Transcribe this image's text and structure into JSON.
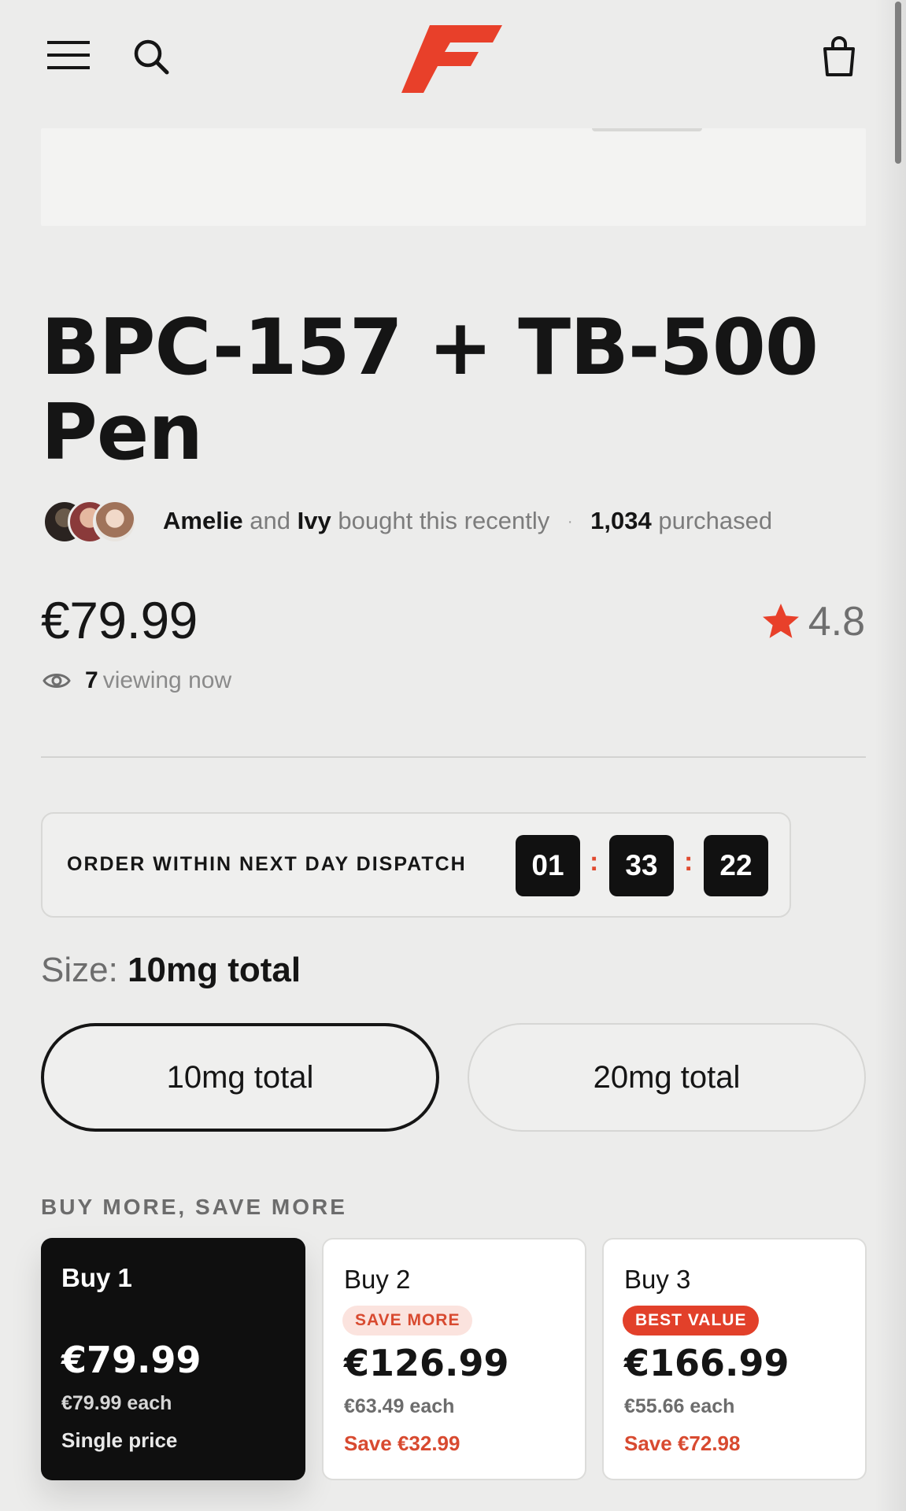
{
  "header": {
    "menu_icon": "hamburger-menu-icon",
    "search_icon": "search-icon",
    "logo": "brand-logo-F",
    "cart_icon": "shopping-bag-icon",
    "brand_color": "#e8402a"
  },
  "product": {
    "title": "BPC-157 + TB-500 Pen",
    "price": "€79.99",
    "rating": "4.8"
  },
  "social_proof": {
    "name1": "Amelie",
    "and_text": "and",
    "name2": "Ivy",
    "recent_text": "bought this recently",
    "separator": "·",
    "purchased_count": "1,034",
    "purchased_text": "purchased"
  },
  "viewing": {
    "count": "7",
    "text": "viewing now"
  },
  "dispatch": {
    "label": "ORDER WITHIN NEXT DAY DISPATCH",
    "hours": "01",
    "minutes": "33",
    "seconds": "22",
    "separator": ":"
  },
  "size": {
    "label": "Size:",
    "selected": "10mg total",
    "options": [
      "10mg total",
      "20mg total"
    ]
  },
  "bundles": {
    "heading": "BUY MORE, SAVE MORE",
    "cards": [
      {
        "title": "Buy 1",
        "badge": "",
        "price": "€79.99",
        "each": "€79.99 each",
        "note": "Single price"
      },
      {
        "title": "Buy 2",
        "badge": "SAVE MORE",
        "price": "€126.99",
        "each": "€63.49 each",
        "note": "Save €32.99"
      },
      {
        "title": "Buy 3",
        "badge": "BEST VALUE",
        "price": "€166.99",
        "each": "€55.66 each",
        "note": "Save €72.98"
      }
    ]
  }
}
